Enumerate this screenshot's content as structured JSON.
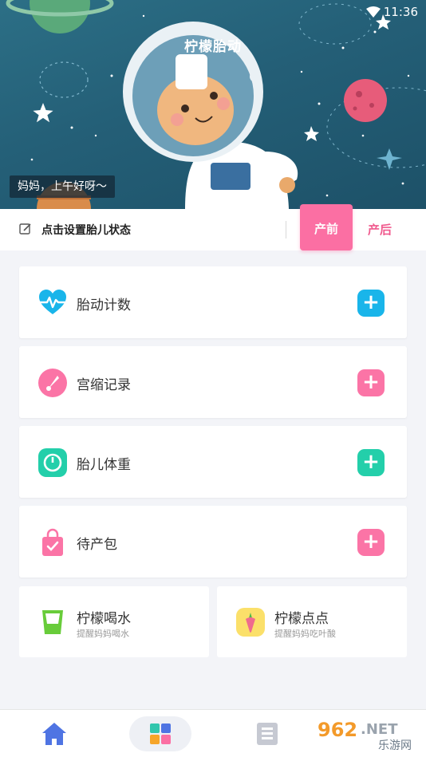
{
  "status_bar": {
    "time": "11:36"
  },
  "hero": {
    "title": "柠檬胎动",
    "greeting": "妈妈，上午好呀～"
  },
  "state_bar": {
    "prompt": "点击设置胎儿状态",
    "tab_pre": "产前",
    "tab_post": "产后"
  },
  "cards": [
    {
      "label": "胎动计数",
      "icon": "heartbeat-icon",
      "color": "#19b5ea",
      "plus": "+"
    },
    {
      "label": "宫缩记录",
      "icon": "gauge-icon",
      "color": "#fb74a6",
      "plus": "+"
    },
    {
      "label": "胎儿体重",
      "icon": "scale-icon",
      "color": "#23cfaa",
      "plus": "+"
    },
    {
      "label": "待产包",
      "icon": "bag-icon",
      "color": "#fb74a6",
      "plus": "+"
    }
  ],
  "water": {
    "title": "柠檬喝水",
    "subtitle": "提醒妈妈喝水",
    "icon": "cup-icon"
  },
  "dots": {
    "title": "柠檬点点",
    "subtitle": "提醒妈妈吃叶酸",
    "icon": "carrot-icon"
  },
  "nav": {
    "home_icon": "home-icon",
    "apps_icon": "apps-icon",
    "list_icon": "list-icon"
  },
  "watermark": {
    "brand": "962",
    "suffix": ".NET",
    "caption": "乐游网"
  }
}
